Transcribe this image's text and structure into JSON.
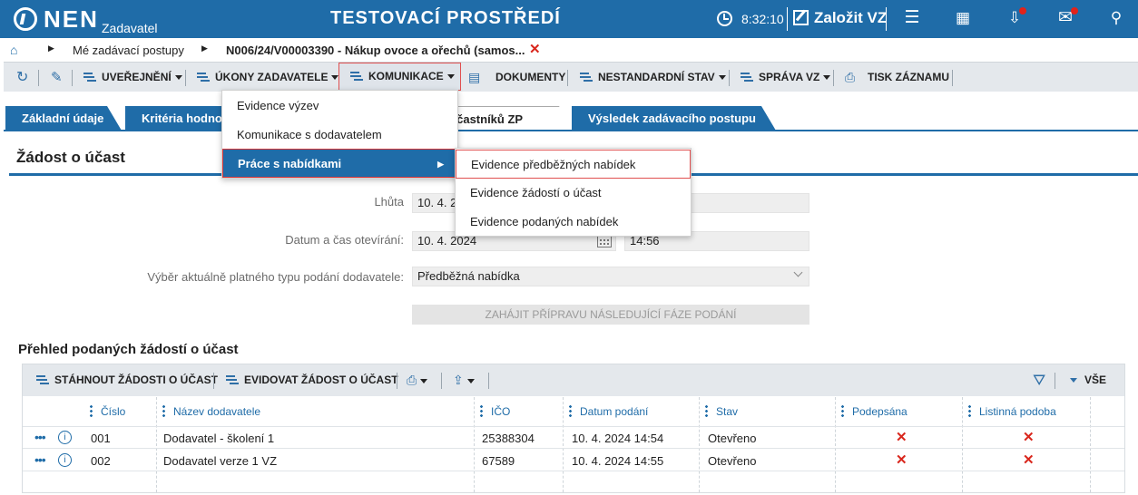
{
  "topbar": {
    "logo_text": "NEN",
    "logo_sub": "Zadavatel",
    "env_title": "TESTOVACÍ PROSTŘEDÍ",
    "time": "8:32:10",
    "new_vz_label": "Založit VZ",
    "icons": [
      "clock-icon",
      "edit-icon",
      "menu-icon",
      "calculator-icon",
      "inbox-icon",
      "mail-icon",
      "user-icon"
    ],
    "accent_color": "#1f6ca8"
  },
  "breadcrumb": {
    "items": [
      "Mé zadávací postupy",
      "N006/24/V00003390 - Nákup ovoce a ořechů (samos..."
    ]
  },
  "toolbar": {
    "items": [
      {
        "label": "UVEŘEJNĚNÍ"
      },
      {
        "label": "ÚKONY ZADAVATELE"
      },
      {
        "label": "KOMUNIKACE"
      },
      {
        "label": "DOKUMENTY"
      },
      {
        "label": "NESTANDARDNÍ STAV"
      },
      {
        "label": "SPRÁVA VZ"
      },
      {
        "label": "TISK ZÁZNAMU"
      }
    ]
  },
  "tabs": [
    {
      "label": "Základní údaje",
      "active": false
    },
    {
      "label": "Kritéria hodno",
      "active": false
    },
    {
      "label": "ní účastníků ZP",
      "active": true
    },
    {
      "label": "Výsledek zadávacího postupu",
      "active": false
    }
  ],
  "section": {
    "title": "Žádost o účast",
    "fields": {
      "lhuta_label": "Lhůta",
      "lhuta_value": "10. 4. 2",
      "datum_label": "Datum a čas otevírání:",
      "datum_value": "10. 4. 2024",
      "cas_value": "14:56",
      "typ_label": "Výběr aktuálně platného typu podání dodavatele:",
      "typ_value": "Předběžná nabídka"
    },
    "next_phase_button": "ZAHÁJIT PŘÍPRAVU NÁSLEDUJÍCÍ FÁZE PODÁNÍ"
  },
  "grid": {
    "title": "Přehled podaných žádostí o účast",
    "toolbar": {
      "download_label": "STÁHNOUT ŽÁDOSTI O ÚČAST",
      "record_label": "EVIDOVAT ŽÁDOST O ÚČAST",
      "all_label": "VŠE"
    },
    "columns": [
      "Číslo",
      "Název dodavatele",
      "IČO",
      "Datum podání",
      "Stav",
      "Podepsána",
      "Listinná podoba"
    ],
    "rows": [
      {
        "cislo": "001",
        "nazev": "Dodavatel - školení 1",
        "ico": "25388304",
        "datum": "10. 4. 2024 14:54",
        "stav": "Otevřeno",
        "podepsana": "✕",
        "listinna": "✕"
      },
      {
        "cislo": "002",
        "nazev": "Dodavatel verze 1 VZ",
        "ico": "67589",
        "datum": "10. 4. 2024 14:55",
        "stav": "Otevřeno",
        "podepsana": "✕",
        "listinna": "✕"
      }
    ]
  },
  "menu_komunikace": {
    "items": [
      "Evidence výzev",
      "Komunikace s dodavatelem",
      "Práce s nabídkami"
    ],
    "selected_index": 2
  },
  "submenu_nabidky": {
    "items": [
      "Evidence předběžných nabídek",
      "Evidence žádostí o účast",
      "Evidence podaných nabídek"
    ],
    "highlighted_index": 0
  }
}
